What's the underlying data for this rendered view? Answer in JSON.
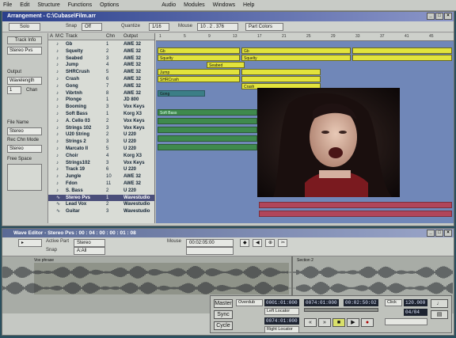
{
  "menu": [
    "File",
    "Edit",
    "Structure",
    "Functions",
    "Options",
    "Audio",
    "Modules",
    "Windows",
    "Help"
  ],
  "main_window": {
    "title": "Arrangement - C:\\Cubase\\Film.arr",
    "toolbar": {
      "solo": "Solo",
      "snap_label": "Snap",
      "snap_value": "Off",
      "quantize_label": "Quantize",
      "quantize_value": "1/16",
      "mouse_label": "Mouse",
      "mouse_value": "10 . 2 . 376",
      "part_colors": "Part Colors"
    }
  },
  "left_panel": {
    "track_info": "Track Info",
    "track_info_value": "Stereo Pvs",
    "output_label": "Output",
    "output_value": "Wavelength",
    "chan_value": "1",
    "chan_label": "Chan",
    "file_name_label": "File Name",
    "file_name_value": "Stereo",
    "rec_mode_label": "Rec Chn Mode",
    "rec_mode_value": "Stereo",
    "free_space_label": "Free Space"
  },
  "track_columns": [
    "A",
    "M",
    "C",
    "Track",
    "Chn",
    "Output"
  ],
  "tracks": [
    {
      "icon": "♪",
      "name": "Gb",
      "chn": "1",
      "out": "AWE 32"
    },
    {
      "icon": "♪",
      "name": "Squelty",
      "chn": "2",
      "out": "AWE 32"
    },
    {
      "icon": "♪",
      "name": "Seabed",
      "chn": "3",
      "out": "AWE 32"
    },
    {
      "icon": "♪",
      "name": "Jump",
      "chn": "4",
      "out": "AWE 32"
    },
    {
      "icon": "♪",
      "name": "SHRCrush",
      "chn": "5",
      "out": "AWE 32"
    },
    {
      "icon": "♪",
      "name": "Crash",
      "chn": "6",
      "out": "AWE 32"
    },
    {
      "icon": "♪",
      "name": "Gong",
      "chn": "7",
      "out": "AWE 32"
    },
    {
      "icon": "♪",
      "name": "Vibrtnh",
      "chn": "8",
      "out": "AWE 32"
    },
    {
      "icon": "♪",
      "name": "Plonge",
      "chn": "1",
      "out": "JD 800"
    },
    {
      "icon": "♪",
      "name": "Booming",
      "chn": "3",
      "out": "Vox Keys"
    },
    {
      "icon": "♪",
      "name": "Soft Bass",
      "chn": "1",
      "out": "Korg X3"
    },
    {
      "icon": "♪",
      "name": "A. Cello 03",
      "chn": "2",
      "out": "Vox Keys"
    },
    {
      "icon": "♪",
      "name": "Strings 102",
      "chn": "3",
      "out": "Vox Keys"
    },
    {
      "icon": "♪",
      "name": "U20 String",
      "chn": "2",
      "out": "U 220"
    },
    {
      "icon": "♪",
      "name": "Strings 2",
      "chn": "3",
      "out": "U 220"
    },
    {
      "icon": "♪",
      "name": "Marcato II",
      "chn": "5",
      "out": "U 220"
    },
    {
      "icon": "♪",
      "name": "Choir",
      "chn": "4",
      "out": "Korg X3"
    },
    {
      "icon": "♪",
      "name": "Strings102",
      "chn": "3",
      "out": "Vox Keys"
    },
    {
      "icon": "♪",
      "name": "Track 19",
      "chn": "6",
      "out": "U 220"
    },
    {
      "icon": "♪",
      "name": "Jungle",
      "chn": "10",
      "out": "AWE 32"
    },
    {
      "icon": "♪",
      "name": "Fdon",
      "chn": "11",
      "out": "AWE 32"
    },
    {
      "icon": "♪",
      "name": "S. Bass",
      "chn": "2",
      "out": "U 220"
    },
    {
      "icon": "∿",
      "name": "Stereo Pvs",
      "chn": "1",
      "out": "Wavestudio"
    },
    {
      "icon": "∿",
      "name": "Lead Vox",
      "chn": "2",
      "out": "Wavestudio"
    },
    {
      "icon": "∿",
      "name": "Guitar",
      "chn": "3",
      "out": "Wavestudio"
    }
  ],
  "ruler_ticks": [
    "1",
    "5",
    "9",
    "13",
    "17",
    "21",
    "25",
    "29",
    "33",
    "37",
    "41",
    "45"
  ],
  "parts": {
    "gb": "Gb",
    "squelty": "Squelty",
    "seabed_sq": "Seabed",
    "jump": "Jump",
    "shrcrush": "SHRCrush",
    "crash": "Crash",
    "gb2": "Gb",
    "squelty2": "Squelty",
    "bass": "Soft Bass",
    "gong": "Gong"
  },
  "lower_window": {
    "title": "Wave Editor - Stereo Pvs : 00 : 04 : 00 : 00 : 01 : 08",
    "active_part_label": "Active Part",
    "active_part_value": "Stereo",
    "mouse_label": "Mouse",
    "mouse_value": "00:02:05:00",
    "snap_label": "Snap",
    "snap_value": "A:All",
    "event1": "Vox phrase",
    "event2": "Section 2"
  },
  "transport": {
    "left_loc": "0001:01:000",
    "right_loc": "0074:01:000",
    "position": "00:02:50:02",
    "tempo": "120.000",
    "signature": "04/04",
    "left_label": "Left Locator",
    "right_label": "Right Locator",
    "master": "Master",
    "click": "Click",
    "sync": "Sync",
    "rec_mode": "Overdub",
    "cycle": "Cycle"
  },
  "colors": {
    "arrange_bg": "#7087b8",
    "part_yellow": "#e2e33c",
    "part_green": "#3f8a4d",
    "transport_lcd": "#1d2330"
  }
}
